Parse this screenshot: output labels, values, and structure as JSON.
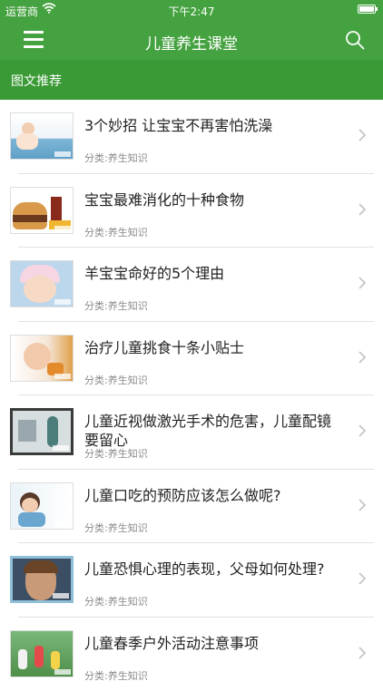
{
  "status_bar": {
    "carrier": "运营商",
    "time": "下午2:47",
    "battery_level": 1.0
  },
  "nav": {
    "title": "儿童养生课堂"
  },
  "section": {
    "title": "图文推荐"
  },
  "articles": [
    {
      "title": "3个妙招 让宝宝不再害怕洗澡",
      "category": "分类:养生知识"
    },
    {
      "title": "宝宝最难消化的十种食物",
      "category": "分类:养生知识"
    },
    {
      "title": "羊宝宝命好的5个理由",
      "category": "分类:养生知识"
    },
    {
      "title": "治疗儿童挑食十条小贴士",
      "category": "分类:养生知识"
    },
    {
      "title": "儿童近视做激光手术的危害，儿童配镜要留心",
      "category": "分类:养生知识"
    },
    {
      "title": "儿童口吃的预防应该怎么做呢?",
      "category": "分类:养生知识"
    },
    {
      "title": "儿童恐惧心理的表现，父母如何处理?",
      "category": "分类:养生知识"
    },
    {
      "title": "儿童春季户外活动注意事项",
      "category": "分类:养生知识"
    }
  ],
  "colors": {
    "primary_green": "#45a240",
    "section_green": "#3a9a35",
    "category_gray": "#8a8a8a"
  }
}
